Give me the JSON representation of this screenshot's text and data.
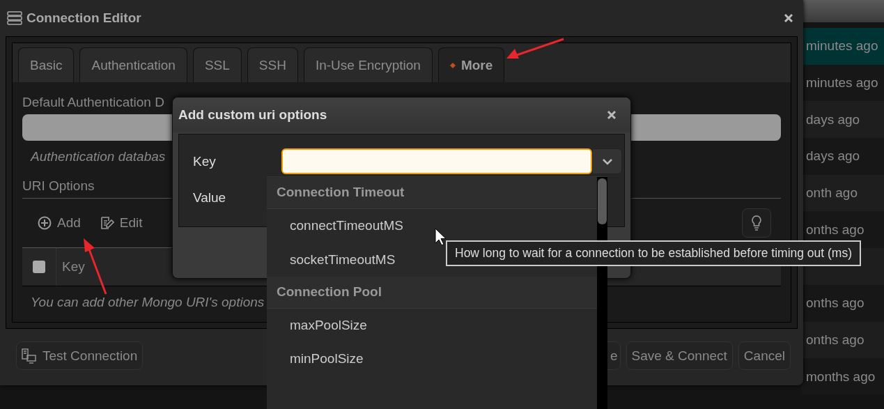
{
  "background_list": {
    "rows": [
      {
        "text": "minutes ago",
        "selected": true
      },
      {
        "text": "minutes ago",
        "selected": false
      },
      {
        "text": "days ago",
        "selected": false
      },
      {
        "text": "days ago",
        "selected": false
      },
      {
        "text": "onth ago",
        "selected": false
      },
      {
        "text": "onths ago",
        "selected": false
      },
      {
        "selected": false
      },
      {
        "text": "onths ago",
        "selected": false
      },
      {
        "text": "onths ago",
        "selected": false
      },
      {
        "text": "months ago",
        "selected": false
      }
    ]
  },
  "connection_editor": {
    "title": "Connection Editor",
    "tabs": [
      {
        "label": "Basic",
        "selected": false
      },
      {
        "label": "Authentication",
        "selected": false
      },
      {
        "label": "SSL",
        "selected": false
      },
      {
        "label": "SSH",
        "selected": false
      },
      {
        "label": "In-Use Encryption",
        "selected": false
      },
      {
        "label": "More",
        "selected": true
      }
    ],
    "auth_db_label": "Default Authentication D",
    "auth_db_hint": "Authentication databas",
    "uri_options_title": "URI Options",
    "toolbar": [
      "Add",
      "Edit"
    ],
    "table": {
      "columns": [
        "Key"
      ],
      "all_checked": false
    },
    "note": "You can add other Mongo URI's options",
    "footer": {
      "left": [
        "Test Connection"
      ],
      "right": [
        "e",
        "Save & Connect",
        "Cancel"
      ]
    }
  },
  "add_uri_dialog": {
    "title": "Add custom uri options",
    "key_label": "Key",
    "value_label": "Value",
    "dropdown": [
      {
        "kind": "group",
        "label": "Connection Timeout"
      },
      {
        "kind": "option",
        "label": "connectTimeoutMS"
      },
      {
        "kind": "option",
        "label": "socketTimeoutMS"
      },
      {
        "kind": "group",
        "label": "Connection Pool"
      },
      {
        "kind": "option",
        "label": "maxPoolSize"
      },
      {
        "kind": "option",
        "label": "minPoolSize"
      },
      {
        "kind": "blank"
      }
    ]
  },
  "tooltip": "How long to wait for a connection to be established before timing out (ms)"
}
